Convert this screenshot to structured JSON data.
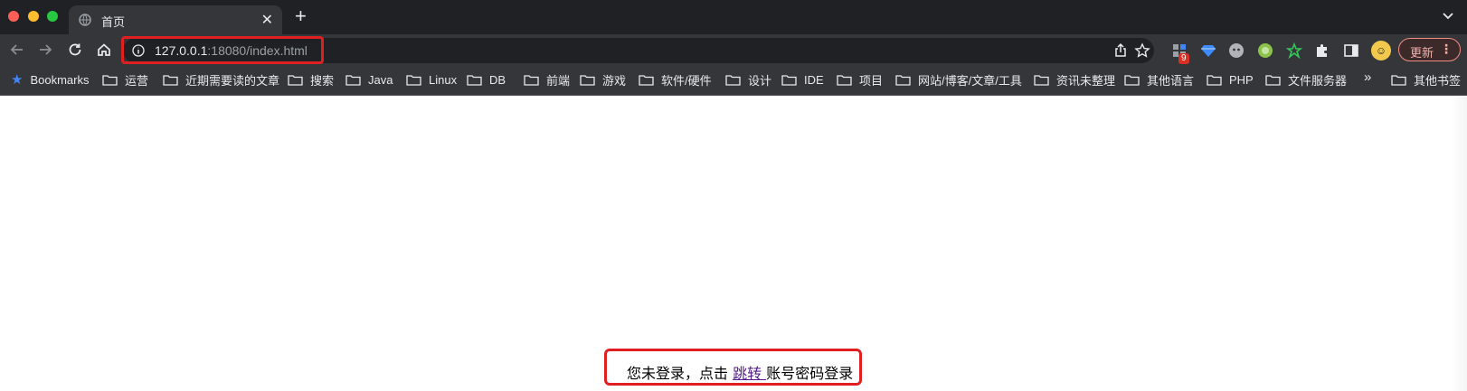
{
  "tab": {
    "title": "首页",
    "close_glyph": "✕",
    "new_tab_glyph": "+",
    "favicon": "globe-icon"
  },
  "address": {
    "host": "127.0.0.1",
    "rest": ":18080/index.html"
  },
  "toolbar": {
    "extension_badge": "9",
    "update_label": "更新",
    "menu_glyph": "⋮"
  },
  "bookmarks": {
    "bookmarks_label": "Bookmarks",
    "items": [
      "运营",
      "近期需要读的文章",
      "搜索",
      "Java",
      "Linux",
      "DB",
      "前端",
      "游戏",
      "软件/硬件",
      "设计",
      "IDE",
      "项目",
      "网站/博客/文章/工具",
      "资讯未整理",
      "其他语言",
      "PHP",
      "文件服务器"
    ],
    "overflow_glyph": "»",
    "other_label": "其他书签"
  },
  "page": {
    "message_before": "您未登录，点击 ",
    "link_text": "跳转 ",
    "message_after": "账号密码登录"
  },
  "colors": {
    "highlight": "#e02020",
    "link_visited": "#551a8b",
    "tab_bg": "#35363a",
    "frame_bg": "#202124"
  }
}
